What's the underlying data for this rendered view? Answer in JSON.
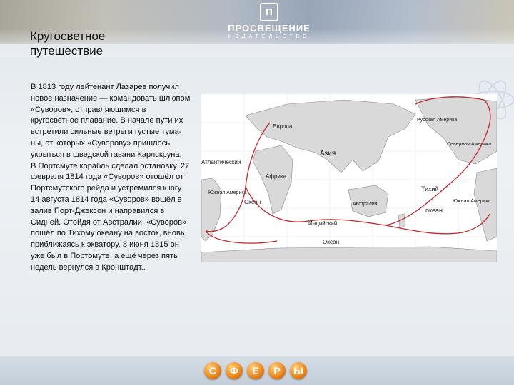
{
  "header": {
    "logo_text": "ПРОСВЕЩЕНИЕ",
    "logo_subtext": "ИЗДАТЕЛЬСТВО"
  },
  "title": {
    "line1": "Кругосветное",
    "line2": "путешествие"
  },
  "body": {
    "paragraph1": "В 1813 году лейтенант Лазарев получил новое назначение — командовать шлюпом «Суворов», отправляющимся в кругосветное плавание. В начале пути их встретили сильные ветры и густые тума-ны, от которых «Суворову» пришлось укрыться в шведской гавани Карлскруна.",
    "paragraph2": "В Портсмуте корабль сделал остановку. 27 февраля 1814 года «Суворов» отошёл от Портсмутского рейда и устремился к югу. 14 августа 1814 года «Суворов» вошёл в залив Порт-Джэксон и направился в Сидней. Отойдя от Австралии, «Суворов» пошёл по Тихому океану на восток, вновь приближаясь к экватору. 8 июня 1815 он уже был в Портомуте, а ещё через пять недель вернулся в Кронштадт.."
  },
  "map": {
    "labels": {
      "europe": "Европа",
      "asia": "Азия",
      "atlantic": "Атлантический",
      "africa": "Африка",
      "south_america": "Южная Америка",
      "russian_america": "Русская Америка",
      "north_america": "Северная Америка",
      "indian": "Индийский",
      "australia": "Австралия",
      "ocean_atl": "Океан",
      "ocean_ind": "Океан",
      "pacific": "Тихий",
      "pacific_ocean": "океан",
      "south_america_east": "Южная Америка"
    },
    "route_color": "#c2272d"
  },
  "footer": {
    "spheres": [
      "С",
      "Ф",
      "Е",
      "Р",
      "Ы"
    ]
  }
}
